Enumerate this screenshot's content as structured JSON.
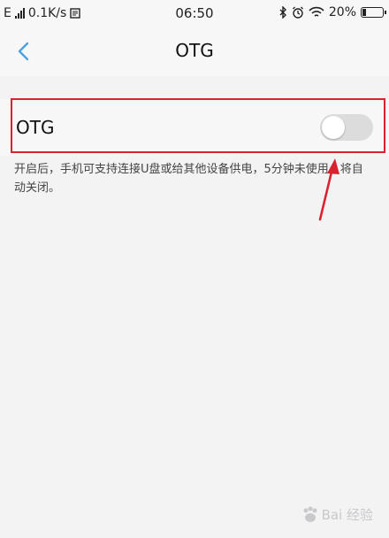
{
  "status_bar": {
    "network_type": "E",
    "speed": "0.1K/s",
    "time": "06:50",
    "battery_percent": "20%",
    "battery_level": 0.2
  },
  "header": {
    "title": "OTG",
    "back_icon": "chevron-left-icon"
  },
  "otg_setting": {
    "label": "OTG",
    "toggle_on": false,
    "description": "开启后，手机可支持连接U盘或给其他设备供电，5分钟未使用，将自动关闭。"
  },
  "colors": {
    "accent": "#4aa3e0",
    "highlight": "#d8232f",
    "toggle_off": "#dcdcdc"
  },
  "watermark": {
    "text": "Bai 经验"
  }
}
